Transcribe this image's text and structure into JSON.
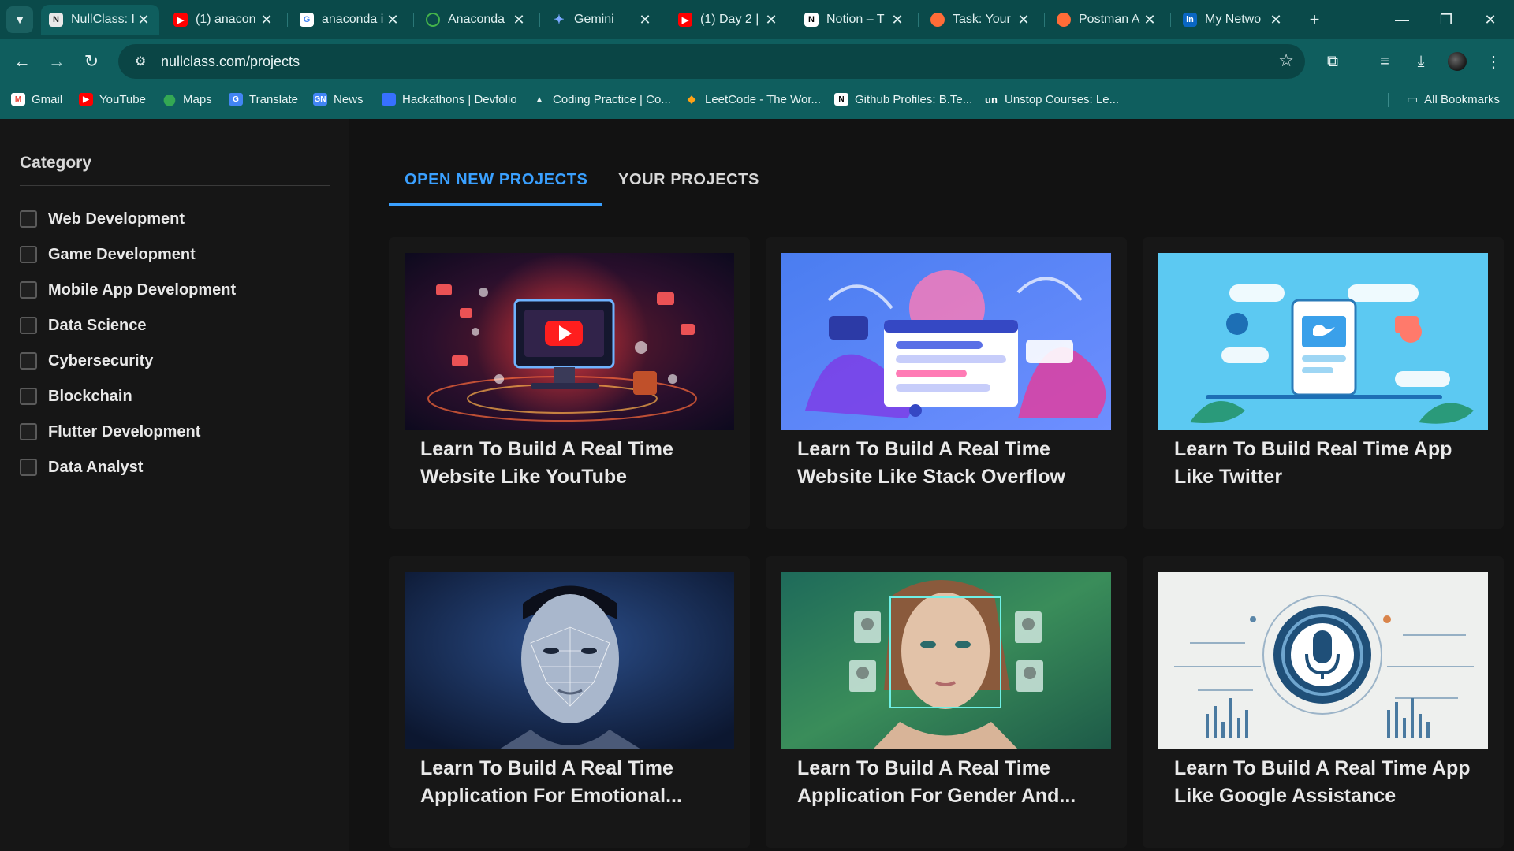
{
  "browser": {
    "tabs": [
      {
        "label": "NullClass: I",
        "favicon": "nullclass-icon",
        "active": true
      },
      {
        "label": "(1) anacon",
        "favicon": "youtube-icon"
      },
      {
        "label": "anaconda i",
        "favicon": "google-icon"
      },
      {
        "label": "Anaconda",
        "favicon": "anaconda-icon"
      },
      {
        "label": "Gemini",
        "favicon": "gemini-icon"
      },
      {
        "label": "(1) Day 2 |",
        "favicon": "youtube-icon"
      },
      {
        "label": "Notion – T",
        "favicon": "notion-icon"
      },
      {
        "label": "Task: Your",
        "favicon": "postman-icon"
      },
      {
        "label": "Postman A",
        "favicon": "postman-icon"
      },
      {
        "label": "My Netwo",
        "favicon": "linkedin-icon"
      }
    ],
    "url": "nullclass.com/projects",
    "bookmarks": [
      {
        "label": "Gmail",
        "icon": "gmail-icon"
      },
      {
        "label": "YouTube",
        "icon": "youtube-icon"
      },
      {
        "label": "Maps",
        "icon": "maps-icon"
      },
      {
        "label": "Translate",
        "icon": "translate-icon"
      },
      {
        "label": "News",
        "icon": "news-icon"
      },
      {
        "label": "Hackathons | Devfolio",
        "icon": "devfolio-icon"
      },
      {
        "label": "Coding Practice | Co...",
        "icon": "coding-icon"
      },
      {
        "label": "LeetCode - The Wor...",
        "icon": "leetcode-icon"
      },
      {
        "label": "Github Profiles: B.Te...",
        "icon": "notion-icon"
      },
      {
        "label": "Unstop Courses: Le...",
        "icon": "unstop-icon"
      }
    ],
    "all_bookmarks": "All Bookmarks",
    "colors": {
      "frame": "#0a4a4a",
      "toolbar": "#0f5e5e"
    }
  },
  "sidebar": {
    "title": "Category",
    "categories": [
      "Web Development",
      "Game Development",
      "Mobile App Development",
      "Data Science",
      "Cybersecurity",
      "Blockchain",
      "Flutter Development",
      "Data Analyst"
    ]
  },
  "tabs": {
    "open_new": "OPEN NEW PROJECTS",
    "your_projects": "YOUR PROJECTS",
    "accent": "#3aa0ff"
  },
  "projects": [
    {
      "line1": "Learn To Build A Real Time",
      "line2": "Website Like YouTube",
      "image": "youtube-illustration"
    },
    {
      "line1": "Learn To Build A Real Time",
      "line2": "Website Like Stack Overflow",
      "image": "stackoverflow-illustration"
    },
    {
      "line1": "Learn To Build Real Time App",
      "line2": "Like Twitter",
      "image": "twitter-illustration"
    },
    {
      "line1": "Learn To Build A Real Time",
      "line2": "Application For Emotional...",
      "image": "face-mesh-illustration"
    },
    {
      "line1": "Learn To Build A Real Time",
      "line2": "Application For Gender And...",
      "image": "face-detection-illustration"
    },
    {
      "line1": "Learn To Build A Real Time App",
      "line2": "Like Google Assistance",
      "image": "microphone-illustration"
    }
  ]
}
